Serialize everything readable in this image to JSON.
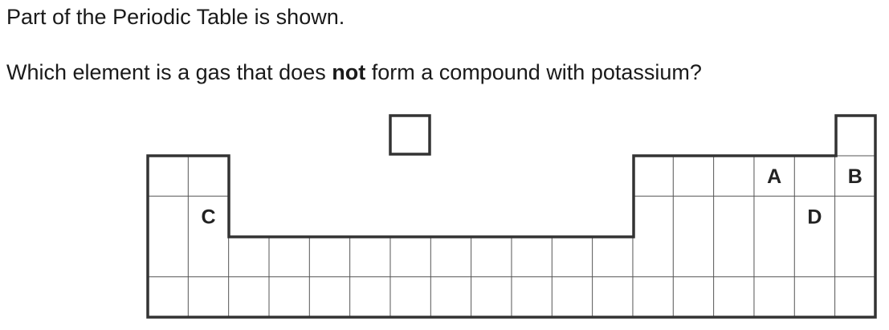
{
  "question": {
    "intro": "Part of the Periodic Table is shown.",
    "prompt_before": "Which element is a gas that does ",
    "prompt_emphasis": "not",
    "prompt_after": " form a compound with potassium?"
  },
  "periodic_table": {
    "columns": 18,
    "rows": 4,
    "labels": [
      {
        "text": "A",
        "row": 2,
        "group": 16
      },
      {
        "text": "B",
        "row": 2,
        "group": 18
      },
      {
        "text": "C",
        "row": 3,
        "group": 2
      },
      {
        "text": "D",
        "row": 3,
        "group": 17
      }
    ]
  }
}
